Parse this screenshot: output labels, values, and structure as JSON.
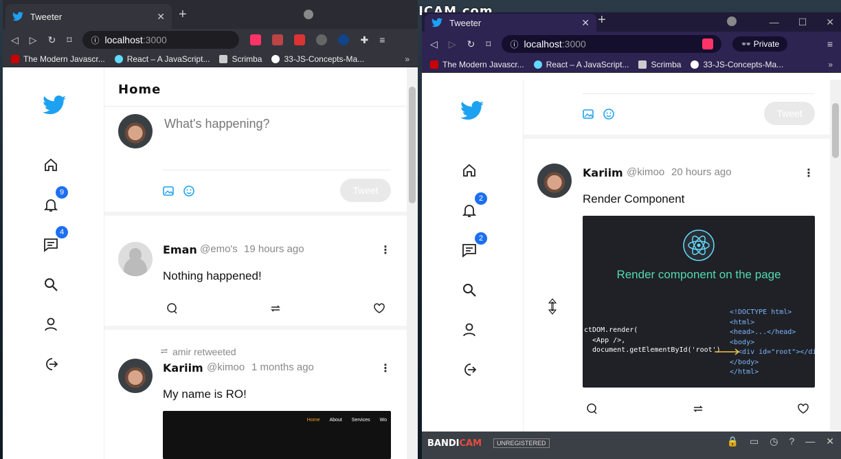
{
  "watermark": "www.BANDICAM.com",
  "windows": [
    {
      "tab_title": "Tweeter",
      "url_host": "localhost",
      "url_port": ":3000",
      "bookmarks": [
        "The Modern Javascr...",
        "React – A JavaScript...",
        "Scrimba",
        "33-JS-Concepts-Ma..."
      ],
      "header_title": "Home",
      "compose_placeholder": "What's happening?",
      "tweet_button": "Tweet",
      "badges": {
        "notifications": "9",
        "messages": "4"
      },
      "tweets": [
        {
          "name": "Eman",
          "handle": "@emo's",
          "time": "19 hours ago",
          "text": "Nothing happened!"
        },
        {
          "retweeted_by": "amir retweeted",
          "name": "Kariim",
          "handle": "@kimoo",
          "time": "1 months ago",
          "text": "My name is RO!",
          "media_nav": [
            "Home",
            "About",
            "Services",
            "Wo"
          ]
        }
      ]
    },
    {
      "tab_title": "Tweeter",
      "url_host": "localhost",
      "url_port": ":3000",
      "private_label": "Private",
      "bookmarks": [
        "The Modern Javascr...",
        "React – A JavaScript...",
        "Scrimba",
        "33-JS-Concepts-Ma..."
      ],
      "tweet_button": "Tweet",
      "badges": {
        "notifications": "2",
        "messages": "2"
      },
      "tweets": [
        {
          "name": "Kariim",
          "handle": "@kimoo",
          "time": "20 hours ago",
          "text": "Render Component",
          "media_title": "Render component on the page",
          "code_left": "ctDOM.render(\n  <App />,\n  document.getElementById('root')",
          "code_right": "<!DOCTYPE html>\n<html>\n<head>...</head>\n<body>\n  <div id=\"root\"></div>\n</body>\n</html>"
        }
      ]
    }
  ],
  "recorder": {
    "brand_a": "BANDI",
    "brand_b": "CAM",
    "status": "UNREGISTERED"
  }
}
